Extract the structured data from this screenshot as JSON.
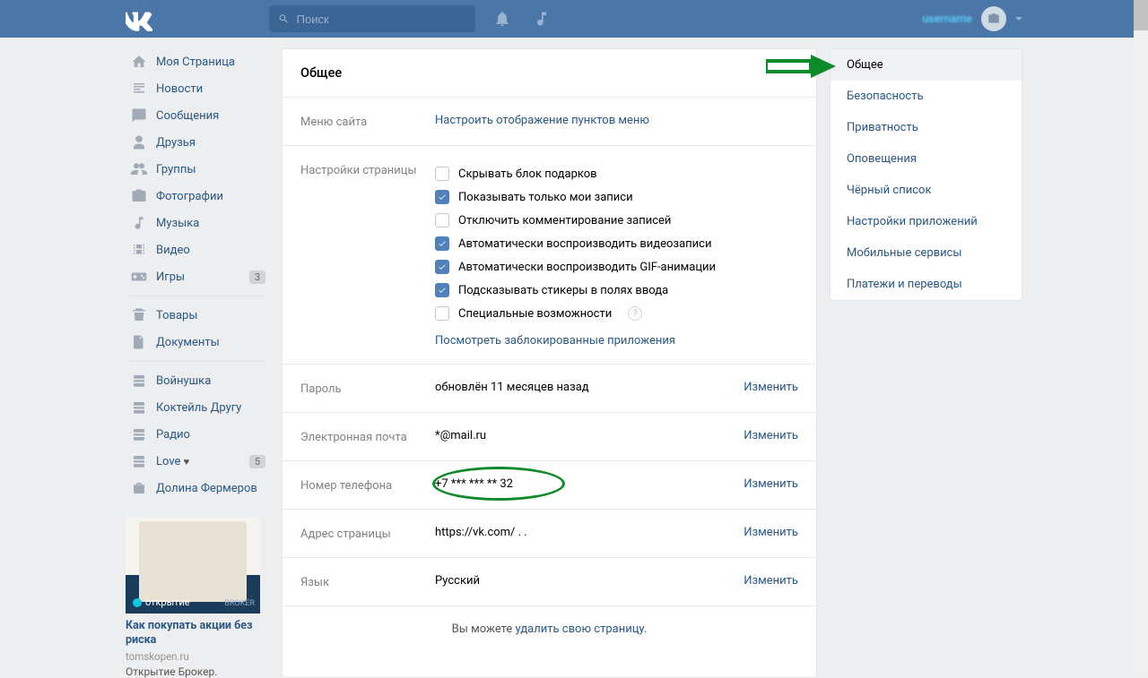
{
  "header": {
    "search_placeholder": "Поиск",
    "username": "username"
  },
  "leftNav": {
    "items": [
      {
        "label": "Моя Страница",
        "icon": "home"
      },
      {
        "label": "Новости",
        "icon": "news"
      },
      {
        "label": "Сообщения",
        "icon": "chat"
      },
      {
        "label": "Друзья",
        "icon": "user"
      },
      {
        "label": "Группы",
        "icon": "users"
      },
      {
        "label": "Фотографии",
        "icon": "camera"
      },
      {
        "label": "Музыка",
        "icon": "note"
      },
      {
        "label": "Видео",
        "icon": "film"
      },
      {
        "label": "Игры",
        "icon": "gamepad",
        "badge": "3"
      }
    ],
    "items2": [
      {
        "label": "Товары",
        "icon": "bag"
      },
      {
        "label": "Документы",
        "icon": "doc"
      }
    ],
    "items3": [
      {
        "label": "Войнушка",
        "icon": "disks"
      },
      {
        "label": "Коктейль Другу",
        "icon": "disks"
      },
      {
        "label": "Радио",
        "icon": "disks"
      },
      {
        "label": "Love",
        "icon": "disks",
        "heart": "♥",
        "badge": "5"
      },
      {
        "label": "Долина Фермеров",
        "icon": "case"
      }
    ]
  },
  "ad": {
    "brand": "открытие",
    "brand_badge": "BROKER",
    "title": "Как покупать акции без риска",
    "domain": "tomskopen.ru",
    "subtitle": "Открытие Брокер."
  },
  "content": {
    "title": "Общее",
    "rows": {
      "menu": {
        "label": "Меню сайта",
        "link": "Настроить отображение пунктов меню"
      },
      "page": {
        "label": "Настройки страницы",
        "checks": [
          {
            "checked": false,
            "text": "Скрывать блок подарков"
          },
          {
            "checked": true,
            "text": "Показывать только мои записи"
          },
          {
            "checked": false,
            "text": "Отключить комментирование записей"
          },
          {
            "checked": true,
            "text": "Автоматически воспроизводить видеозаписи"
          },
          {
            "checked": true,
            "text": "Автоматически воспроизводить GIF-анимации"
          },
          {
            "checked": true,
            "text": "Подсказывать стикеры в полях ввода"
          },
          {
            "checked": false,
            "text": "Специальные возможности",
            "help": true
          }
        ],
        "blocked_link": "Посмотреть заблокированные приложения"
      },
      "password": {
        "label": "Пароль",
        "value": "обновлён 11 месяцев назад",
        "action": "Изменить"
      },
      "email": {
        "label": "Электронная почта",
        "value": "    *@mail.ru",
        "action": "Изменить"
      },
      "phone": {
        "label": "Номер телефона",
        "value": "+7 *** *** ** 32",
        "action": "Изменить"
      },
      "address": {
        "label": "Адрес страницы",
        "value": "https://vk.com/  .    .",
        "action": "Изменить"
      },
      "lang": {
        "label": "Язык",
        "value": "Русский",
        "action": "Изменить"
      }
    },
    "footer_prefix": "Вы можете ",
    "footer_link": "удалить свою страницу."
  },
  "settingsNav": [
    "Общее",
    "Безопасность",
    "Приватность",
    "Оповещения",
    "Чёрный список",
    "Настройки приложений",
    "Мобильные сервисы",
    "Платежи и переводы"
  ]
}
